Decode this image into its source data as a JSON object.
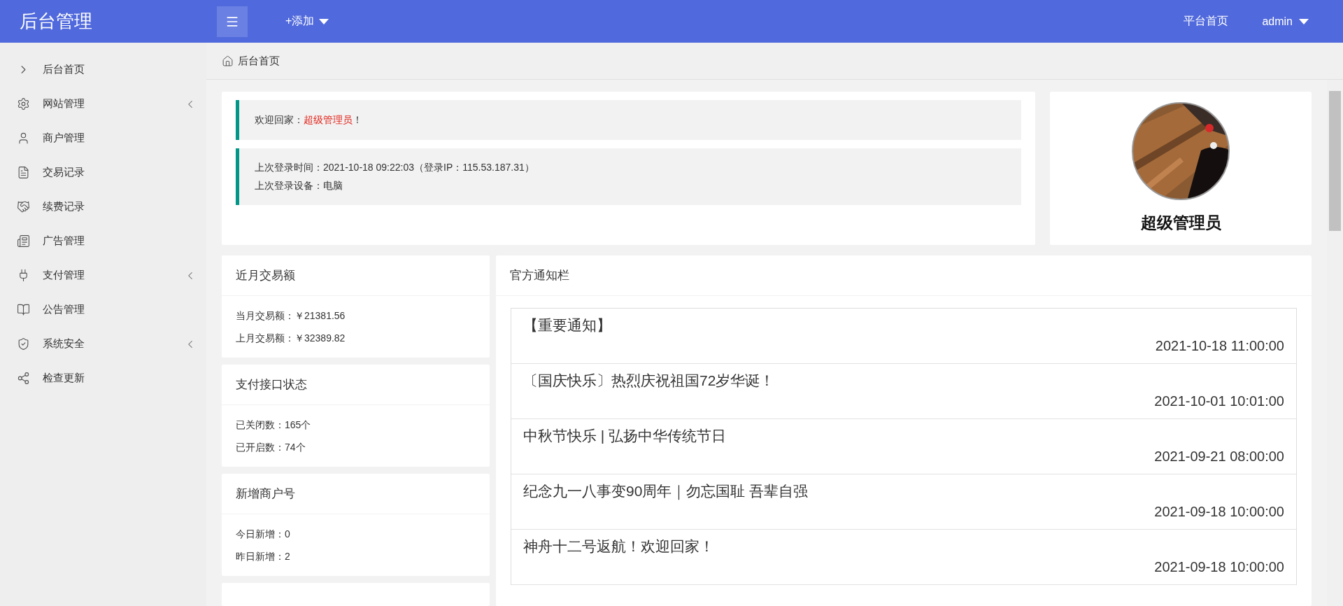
{
  "header": {
    "logo": "后台管理",
    "add_menu": "+添加",
    "links": [
      {
        "label": "平台首页",
        "caret": false
      },
      {
        "label": "admin",
        "caret": true
      }
    ]
  },
  "sidebar": {
    "items": [
      {
        "label": "后台首页",
        "submenu": false
      },
      {
        "label": "网站管理",
        "submenu": true
      },
      {
        "label": "商户管理",
        "submenu": false
      },
      {
        "label": "交易记录",
        "submenu": false
      },
      {
        "label": "续费记录",
        "submenu": false
      },
      {
        "label": "广告管理",
        "submenu": false
      },
      {
        "label": "支付管理",
        "submenu": true
      },
      {
        "label": "公告管理",
        "submenu": false
      },
      {
        "label": "系统安全",
        "submenu": true
      },
      {
        "label": "检查更新",
        "submenu": false
      }
    ]
  },
  "breadcrumb": "后台首页",
  "welcome": {
    "greeting": "欢迎回家：",
    "user": "超级管理员",
    "suffix": "！",
    "login_lines": [
      "上次登录时间：2021-10-18 09:22:03（登录IP：115.53.187.31）",
      "上次登录设备：电脑"
    ]
  },
  "profile": {
    "name": "超级管理员"
  },
  "stat_cards": [
    {
      "title": "近月交易额",
      "lines": [
        "当月交易额：￥21381.56",
        "上月交易额：￥32389.82"
      ]
    },
    {
      "title": "支付接口状态",
      "lines": [
        "已关闭数：165个",
        "已开启数：74个"
      ]
    },
    {
      "title": "新增商户号",
      "lines": [
        "今日新增：0",
        "昨日新增：2"
      ]
    }
  ],
  "notices": {
    "title": "官方通知栏",
    "items": [
      {
        "title": "【重要通知】",
        "date": "2021-10-18 11:00:00"
      },
      {
        "title": "〔国庆快乐〕热烈庆祝祖国72岁华诞！",
        "date": "2021-10-01 10:01:00"
      },
      {
        "title": "中秋节快乐 | 弘扬中华传统节日",
        "date": "2021-09-21 08:00:00"
      },
      {
        "title": "纪念九一八事变90周年｜勿忘国耻 吾辈自强",
        "date": "2021-09-18 10:00:00"
      },
      {
        "title": "神舟十二号返航！欢迎回家！",
        "date": "2021-09-18 10:00:00"
      }
    ]
  }
}
